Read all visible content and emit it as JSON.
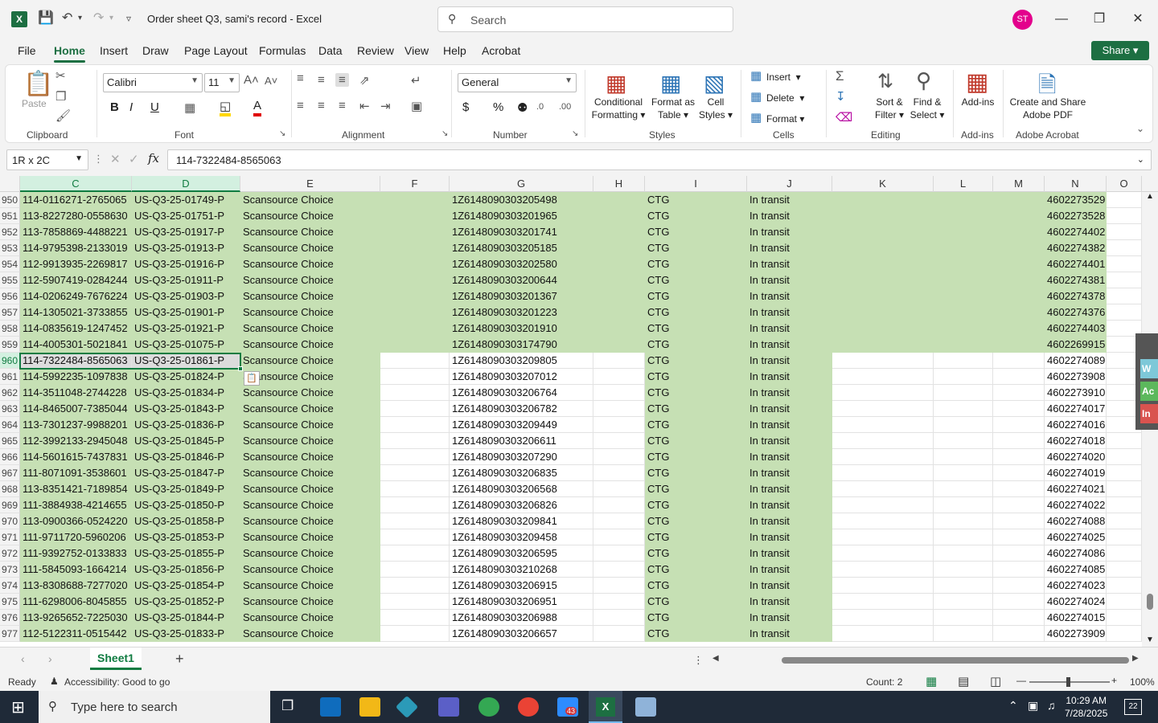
{
  "window": {
    "title": "Order sheet Q3, sami's record  -  Excel",
    "search_placeholder": "Search",
    "avatar_initials": "ST"
  },
  "ribbon_tabs": [
    "File",
    "Home",
    "Insert",
    "Draw",
    "Page Layout",
    "Formulas",
    "Data",
    "Review",
    "View",
    "Help",
    "Acrobat"
  ],
  "active_tab": "Home",
  "share_label": "Share",
  "ribbon": {
    "clipboard": {
      "label": "Clipboard",
      "paste": "Paste"
    },
    "font": {
      "label": "Font",
      "name": "Calibri",
      "size": "11"
    },
    "alignment": {
      "label": "Alignment"
    },
    "number": {
      "label": "Number",
      "format": "General"
    },
    "styles": {
      "label": "Styles",
      "conditional_1": "Conditional",
      "conditional_2": "Formatting",
      "format_table_1": "Format as",
      "format_table_2": "Table",
      "cell_styles_1": "Cell",
      "cell_styles_2": "Styles"
    },
    "cells": {
      "label": "Cells",
      "insert": "Insert",
      "delete": "Delete",
      "format": "Format"
    },
    "editing": {
      "label": "Editing",
      "sort_1": "Sort &",
      "sort_2": "Filter",
      "find_1": "Find &",
      "find_2": "Select"
    },
    "addins": {
      "label": "Add-ins",
      "button": "Add-ins"
    },
    "acrobat": {
      "label": "Adobe Acrobat",
      "btn_1": "Create and Share",
      "btn_2": "Adobe PDF"
    }
  },
  "formula_bar": {
    "name_box": "1R x 2C",
    "formula": "114-7322484-8565063"
  },
  "columns": [
    "C",
    "D",
    "E",
    "F",
    "G",
    "H",
    "I",
    "J",
    "K",
    "L",
    "M",
    "N",
    "O"
  ],
  "rows": [
    {
      "num": "950",
      "c": "114-0116271-2765065",
      "d": "US-Q3-25-01749-P",
      "e": "Scansource Choice",
      "g": "1Z6148090303205498",
      "i": "CTG",
      "j": "In transit",
      "n": "4602273529"
    },
    {
      "num": "951",
      "c": "113-8227280-0558630",
      "d": "US-Q3-25-01751-P",
      "e": "Scansource Choice",
      "g": "1Z6148090303201965",
      "i": "CTG",
      "j": "In transit",
      "n": "4602273528"
    },
    {
      "num": "952",
      "c": "113-7858869-4488221",
      "d": "US-Q3-25-01917-P",
      "e": "Scansource Choice",
      "g": "1Z6148090303201741",
      "i": "CTG",
      "j": "In transit",
      "n": "4602274402"
    },
    {
      "num": "953",
      "c": "114-9795398-2133019",
      "d": "US-Q3-25-01913-P",
      "e": "Scansource Choice",
      "g": "1Z6148090303205185",
      "i": "CTG",
      "j": "In transit",
      "n": "4602274382"
    },
    {
      "num": "954",
      "c": "112-9913935-2269817",
      "d": "US-Q3-25-01916-P",
      "e": "Scansource Choice",
      "g": "1Z6148090303202580",
      "i": "CTG",
      "j": "In transit",
      "n": "4602274401"
    },
    {
      "num": "955",
      "c": "112-5907419-0284244",
      "d": "US-Q3-25-01911-P",
      "e": "Scansource Choice",
      "g": "1Z6148090303200644",
      "i": "CTG",
      "j": "In transit",
      "n": "4602274381"
    },
    {
      "num": "956",
      "c": "114-0206249-7676224",
      "d": "US-Q3-25-01903-P",
      "e": "Scansource Choice",
      "g": "1Z6148090303201367",
      "i": "CTG",
      "j": "In transit",
      "n": "4602274378"
    },
    {
      "num": "957",
      "c": "114-1305021-3733855",
      "d": "US-Q3-25-01901-P",
      "e": "Scansource Choice",
      "g": "1Z6148090303201223",
      "i": "CTG",
      "j": "In transit",
      "n": "4602274376"
    },
    {
      "num": "958",
      "c": "114-0835619-1247452",
      "d": "US-Q3-25-01921-P",
      "e": "Scansource Choice",
      "g": "1Z6148090303201910",
      "i": "CTG",
      "j": "In transit",
      "n": "4602274403"
    },
    {
      "num": "959",
      "c": "114-4005301-5021841",
      "d": "US-Q3-25-01075-P",
      "e": "Scansource Choice",
      "g": "1Z6148090303174790",
      "i": "CTG",
      "j": "In transit",
      "n": "4602269915"
    },
    {
      "num": "960",
      "c": "114-7322484-8565063",
      "d": "US-Q3-25-01861-P",
      "e": "Scansource Choice",
      "g": "1Z6148090303209805",
      "i": "CTG",
      "j": "In transit",
      "n": "4602274089"
    },
    {
      "num": "961",
      "c": "114-5992235-1097838",
      "d": "US-Q3-25-01824-P",
      "e": "Scansource Choice",
      "g": "1Z6148090303207012",
      "i": "CTG",
      "j": "In transit",
      "n": "4602273908"
    },
    {
      "num": "962",
      "c": "114-3511048-2744228",
      "d": "US-Q3-25-01834-P",
      "e": "Scansource Choice",
      "g": "1Z6148090303206764",
      "i": "CTG",
      "j": "In transit",
      "n": "4602273910"
    },
    {
      "num": "963",
      "c": "114-8465007-7385044",
      "d": "US-Q3-25-01843-P",
      "e": "Scansource Choice",
      "g": "1Z6148090303206782",
      "i": "CTG",
      "j": "In transit",
      "n": "4602274017"
    },
    {
      "num": "964",
      "c": "113-7301237-9988201",
      "d": "US-Q3-25-01836-P",
      "e": "Scansource Choice",
      "g": "1Z6148090303209449",
      "i": "CTG",
      "j": "In transit",
      "n": "4602274016"
    },
    {
      "num": "965",
      "c": "112-3992133-2945048",
      "d": "US-Q3-25-01845-P",
      "e": "Scansource Choice",
      "g": "1Z6148090303206611",
      "i": "CTG",
      "j": "In transit",
      "n": "4602274018"
    },
    {
      "num": "966",
      "c": "114-5601615-7437831",
      "d": "US-Q3-25-01846-P",
      "e": "Scansource Choice",
      "g": "1Z6148090303207290",
      "i": "CTG",
      "j": "In transit",
      "n": "4602274020"
    },
    {
      "num": "967",
      "c": "111-8071091-3538601",
      "d": "US-Q3-25-01847-P",
      "e": "Scansource Choice",
      "g": "1Z6148090303206835",
      "i": "CTG",
      "j": "In transit",
      "n": "4602274019"
    },
    {
      "num": "968",
      "c": "113-8351421-7189854",
      "d": "US-Q3-25-01849-P",
      "e": "Scansource Choice",
      "g": "1Z6148090303206568",
      "i": "CTG",
      "j": "In transit",
      "n": "4602274021"
    },
    {
      "num": "969",
      "c": "111-3884938-4214655",
      "d": "US-Q3-25-01850-P",
      "e": "Scansource Choice",
      "g": "1Z6148090303206826",
      "i": "CTG",
      "j": "In transit",
      "n": "4602274022"
    },
    {
      "num": "970",
      "c": "113-0900366-0524220",
      "d": "US-Q3-25-01858-P",
      "e": "Scansource Choice",
      "g": "1Z6148090303209841",
      "i": "CTG",
      "j": "In transit",
      "n": "4602274088"
    },
    {
      "num": "971",
      "c": "111-9711720-5960206",
      "d": "US-Q3-25-01853-P",
      "e": "Scansource Choice",
      "g": "1Z6148090303209458",
      "i": "CTG",
      "j": "In transit",
      "n": "4602274025"
    },
    {
      "num": "972",
      "c": "111-9392752-0133833",
      "d": "US-Q3-25-01855-P",
      "e": "Scansource Choice",
      "g": "1Z6148090303206595",
      "i": "CTG",
      "j": "In transit",
      "n": "4602274086"
    },
    {
      "num": "973",
      "c": "111-5845093-1664214",
      "d": "US-Q3-25-01856-P",
      "e": "Scansource Choice",
      "g": "1Z6148090303210268",
      "i": "CTG",
      "j": "In transit",
      "n": "4602274085"
    },
    {
      "num": "974",
      "c": "113-8308688-7277020",
      "d": "US-Q3-25-01854-P",
      "e": "Scansource Choice",
      "g": "1Z6148090303206915",
      "i": "CTG",
      "j": "In transit",
      "n": "4602274023"
    },
    {
      "num": "975",
      "c": "111-6298006-8045855",
      "d": "US-Q3-25-01852-P",
      "e": "Scansource Choice",
      "g": "1Z6148090303206951",
      "i": "CTG",
      "j": "In transit",
      "n": "4602274024"
    },
    {
      "num": "976",
      "c": "113-9265652-7225030",
      "d": "US-Q3-25-01844-P",
      "e": "Scansource Choice",
      "g": "1Z6148090303206988",
      "i": "CTG",
      "j": "In transit",
      "n": "4602274015"
    },
    {
      "num": "977",
      "c": "112-5122311-0515442",
      "d": "US-Q3-25-01833-P",
      "e": "Scansource Choice",
      "g": "1Z6148090303206657",
      "i": "CTG",
      "j": "In transit",
      "n": "4602273909"
    }
  ],
  "side_panel": [
    "W",
    "Ac",
    "In"
  ],
  "sheet": {
    "name": "Sheet1",
    "add": "+"
  },
  "status": {
    "ready": "Ready",
    "accessibility": "Accessibility: Good to go",
    "count": "Count: 2",
    "zoom": "100%"
  },
  "taskbar": {
    "search_placeholder": "Type here to search",
    "time": "10:29 AM",
    "date": "7/28/2025",
    "notifications": "22",
    "zoom_badge": "43"
  },
  "colors": {
    "excel_green": "#1d6f42",
    "fill_green": "#c6e0b4",
    "selection_gray": "#dcdcdc"
  }
}
